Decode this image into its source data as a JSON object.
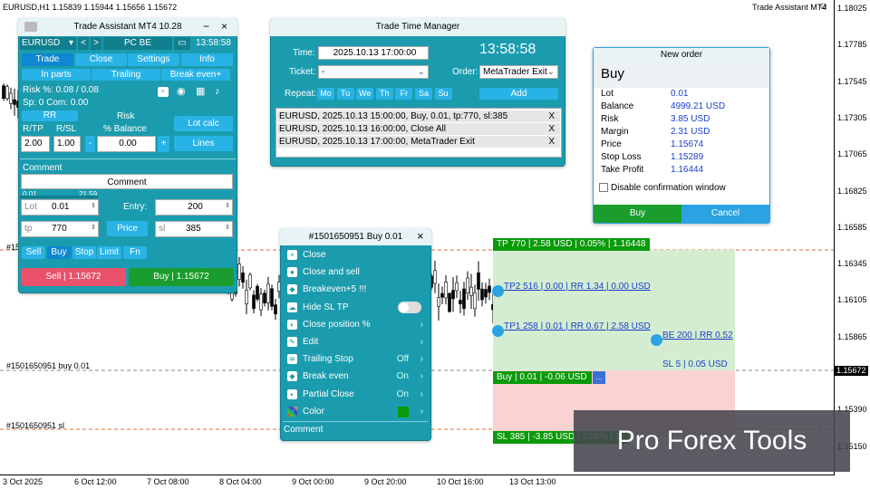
{
  "symbol_header": "EURUSD,H1  1.15839 1.15944 1.15656 1.15672",
  "top_right_label": "Trade Assistant MT4",
  "price_labels": [
    "1.18025",
    "1.17785",
    "1.17545",
    "1.17305",
    "1.17065",
    "1.16825",
    "1.16585",
    "1.16345",
    "1.16105",
    "1.15865",
    "1.15625",
    "1.15390",
    "1.15150"
  ],
  "current_price": "1.15672",
  "time_labels": [
    "3 Oct 2025",
    "6 Oct 12:00",
    "7 Oct 08:00",
    "8 Oct 04:00",
    "9 Oct 00:00",
    "9 Oct 20:00",
    "10 Oct 16:00",
    "13 Oct 13:00"
  ],
  "chart_labels": {
    "line_mid": "#1501650951 buy 0.01",
    "line_sl": "#1501650951 sl",
    "line_top": "#15"
  },
  "trade_levels": {
    "tp": "TP 770 | 2.58 USD | 0.05% | 1.16448",
    "tp2": "TP2 516 | 0.00 | RR 1.34 | 0.00 USD",
    "tp1": "TP1 258 | 0.01 | RR 0.67 | 2.58 USD",
    "be": "BE 200 | RR 0.52",
    "sl5": "SL 5 | 0.05 USD",
    "buy": "Buy | 0.01 | -0.06 USD",
    "buy_more": "...",
    "sl": "SL 385 | -3.85 USD | 0.08% | 1."
  },
  "watermark": "Pro Forex Tools",
  "trade_assistant": {
    "title": "Trade Assistant MT4 10.28",
    "symbol": "EURUSD",
    "prev": "<",
    "next": ">",
    "pc_be": "PC BE",
    "folder": "📁",
    "time": "13:58:58",
    "tabs": [
      "Trade",
      "Close",
      "Settings",
      "Info"
    ],
    "subtabs": [
      "In parts",
      "Trailing",
      "Break even+"
    ],
    "risk_line": "Risk %: 0.08 / 0.08",
    "sp_line": "Sp: 0  Com: 0.00",
    "rr": "RR",
    "rtp": "R/TP",
    "rsl": "R/SL",
    "risk": "Risk",
    "pct_balance": "% Balance",
    "rtp_val": "2.00",
    "rsl_val": "1.00",
    "minus": "-",
    "risk_val": "0.00",
    "plus": "+",
    "lot_calc": "Lot calc",
    "lines": "Lines",
    "comment_label": "Comment",
    "comment_btn": "Comment",
    "slider_min": "0.01",
    "slider_max": "21.59",
    "lot_ph": "Lot",
    "lot_val": "0.01",
    "entry": "Entry:",
    "entry_val": "200",
    "tp_ph": "tp",
    "tp_val": "770",
    "price": "Price",
    "sl_ph": "sl",
    "sl_val": "385",
    "order_types": [
      "Sell",
      "Buy",
      "Stop",
      "Limit",
      "Fn"
    ],
    "sell_btn": "Sell  | 1.15672",
    "buy_btn": "Buy  | 1.15672"
  },
  "time_manager": {
    "title": "Trade Time Manager",
    "time_label": "Time:",
    "time_val": "2025.10.13 17:00:00",
    "clock": "13:58:58",
    "ticket_label": "Ticket:",
    "ticket_val": "-",
    "order_label": "Order:",
    "order_val": "MetaTrader Exit",
    "repeat_label": "Repeat:",
    "days": [
      "Mo",
      "Tu",
      "We",
      "Th",
      "Fr",
      "Sa",
      "Su"
    ],
    "add": "Add",
    "rows": [
      "EURUSD, 2025.10.13 15:00:00, Buy, 0.01, tp:770, sl:385",
      "EURUSD, 2025.10.13 16:00:00, Close All",
      "EURUSD, 2025.10.13 17:00:00, MetaTrader Exit"
    ],
    "x": "X"
  },
  "new_order": {
    "title": "New order",
    "side": "Buy",
    "rows": [
      {
        "k": "Lot",
        "v": "0.01"
      },
      {
        "k": "Balance",
        "v": "4999.21 USD"
      },
      {
        "k": "Risk",
        "v": "3.85 USD"
      },
      {
        "k": "Margin",
        "v": "2.31 USD"
      },
      {
        "k": "Price",
        "v": "1.15674"
      },
      {
        "k": "Stop Loss",
        "v": "1.15289"
      },
      {
        "k": "Take Profit",
        "v": "1.16444"
      }
    ],
    "disable": "Disable confirmation window",
    "buy": "Buy",
    "cancel": "Cancel"
  },
  "context_menu": {
    "title": "#1501650951 Buy 0.01",
    "close_x": "×",
    "items": [
      {
        "label": "Close",
        "value": "",
        "chev": ""
      },
      {
        "label": "Close and sell",
        "value": "",
        "chev": ""
      },
      {
        "label": "Breakeven+5 !!!",
        "value": "",
        "chev": ""
      },
      {
        "label": "Hide SL TP",
        "value": "",
        "chev": ""
      },
      {
        "label": "Close position %",
        "value": "",
        "chev": "›"
      },
      {
        "label": "Edit",
        "value": "",
        "chev": "›"
      },
      {
        "label": "Trailing Stop",
        "value": "Off",
        "chev": "›"
      },
      {
        "label": "Break even",
        "value": "On",
        "chev": "›"
      },
      {
        "label": "Partial Close",
        "value": "On",
        "chev": "›"
      },
      {
        "label": "Color",
        "value": "",
        "chev": "›"
      }
    ],
    "comment": "Comment"
  }
}
